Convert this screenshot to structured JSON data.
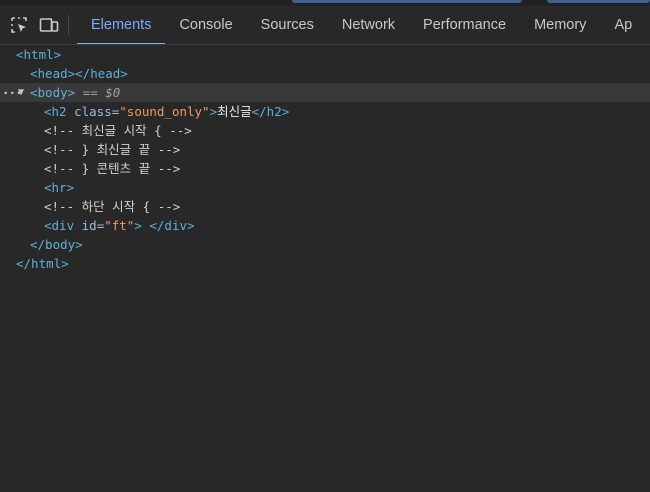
{
  "toolbar": {
    "icons": [
      "inspect-element-icon",
      "device-toolbar-icon"
    ],
    "tabs": [
      {
        "label": "Elements",
        "active": true
      },
      {
        "label": "Console",
        "active": false
      },
      {
        "label": "Sources",
        "active": false
      },
      {
        "label": "Network",
        "active": false
      },
      {
        "label": "Performance",
        "active": false
      },
      {
        "label": "Memory",
        "active": false
      },
      {
        "label": "Ap",
        "active": false
      }
    ]
  },
  "tree": {
    "html_open": "<html>",
    "head": "<head></head>",
    "body_open": "<body>",
    "body_selected_marker": "== $0",
    "ellipsis": "···",
    "h2_open_tag": "<h2 ",
    "h2_attr_name": "class=",
    "h2_attr_value": "\"sound_only\"",
    "h2_close_bracket": ">",
    "h2_text": "최신글",
    "h2_close_tag": "</h2>",
    "comment1": "<!-- 최신글 시작 { -->",
    "comment2": "<!-- } 최신글 끝 -->",
    "comment3": "<!-- } 콘텐츠 끝 -->",
    "hr": "<hr>",
    "comment4": "<!-- 하단 시작 { -->",
    "div_open_tag": "<div ",
    "div_attr_name": "id=",
    "div_attr_value": "\"ft\"",
    "div_close": "> </div>",
    "body_close": "</body>",
    "html_close": "</html>"
  },
  "colors": {
    "background": "#282828",
    "tag": "#5db0d7",
    "attr_name": "#9bbbdc",
    "attr_value": "#f29766",
    "active_tab": "#7cacf8",
    "selected_row": "#393939"
  }
}
